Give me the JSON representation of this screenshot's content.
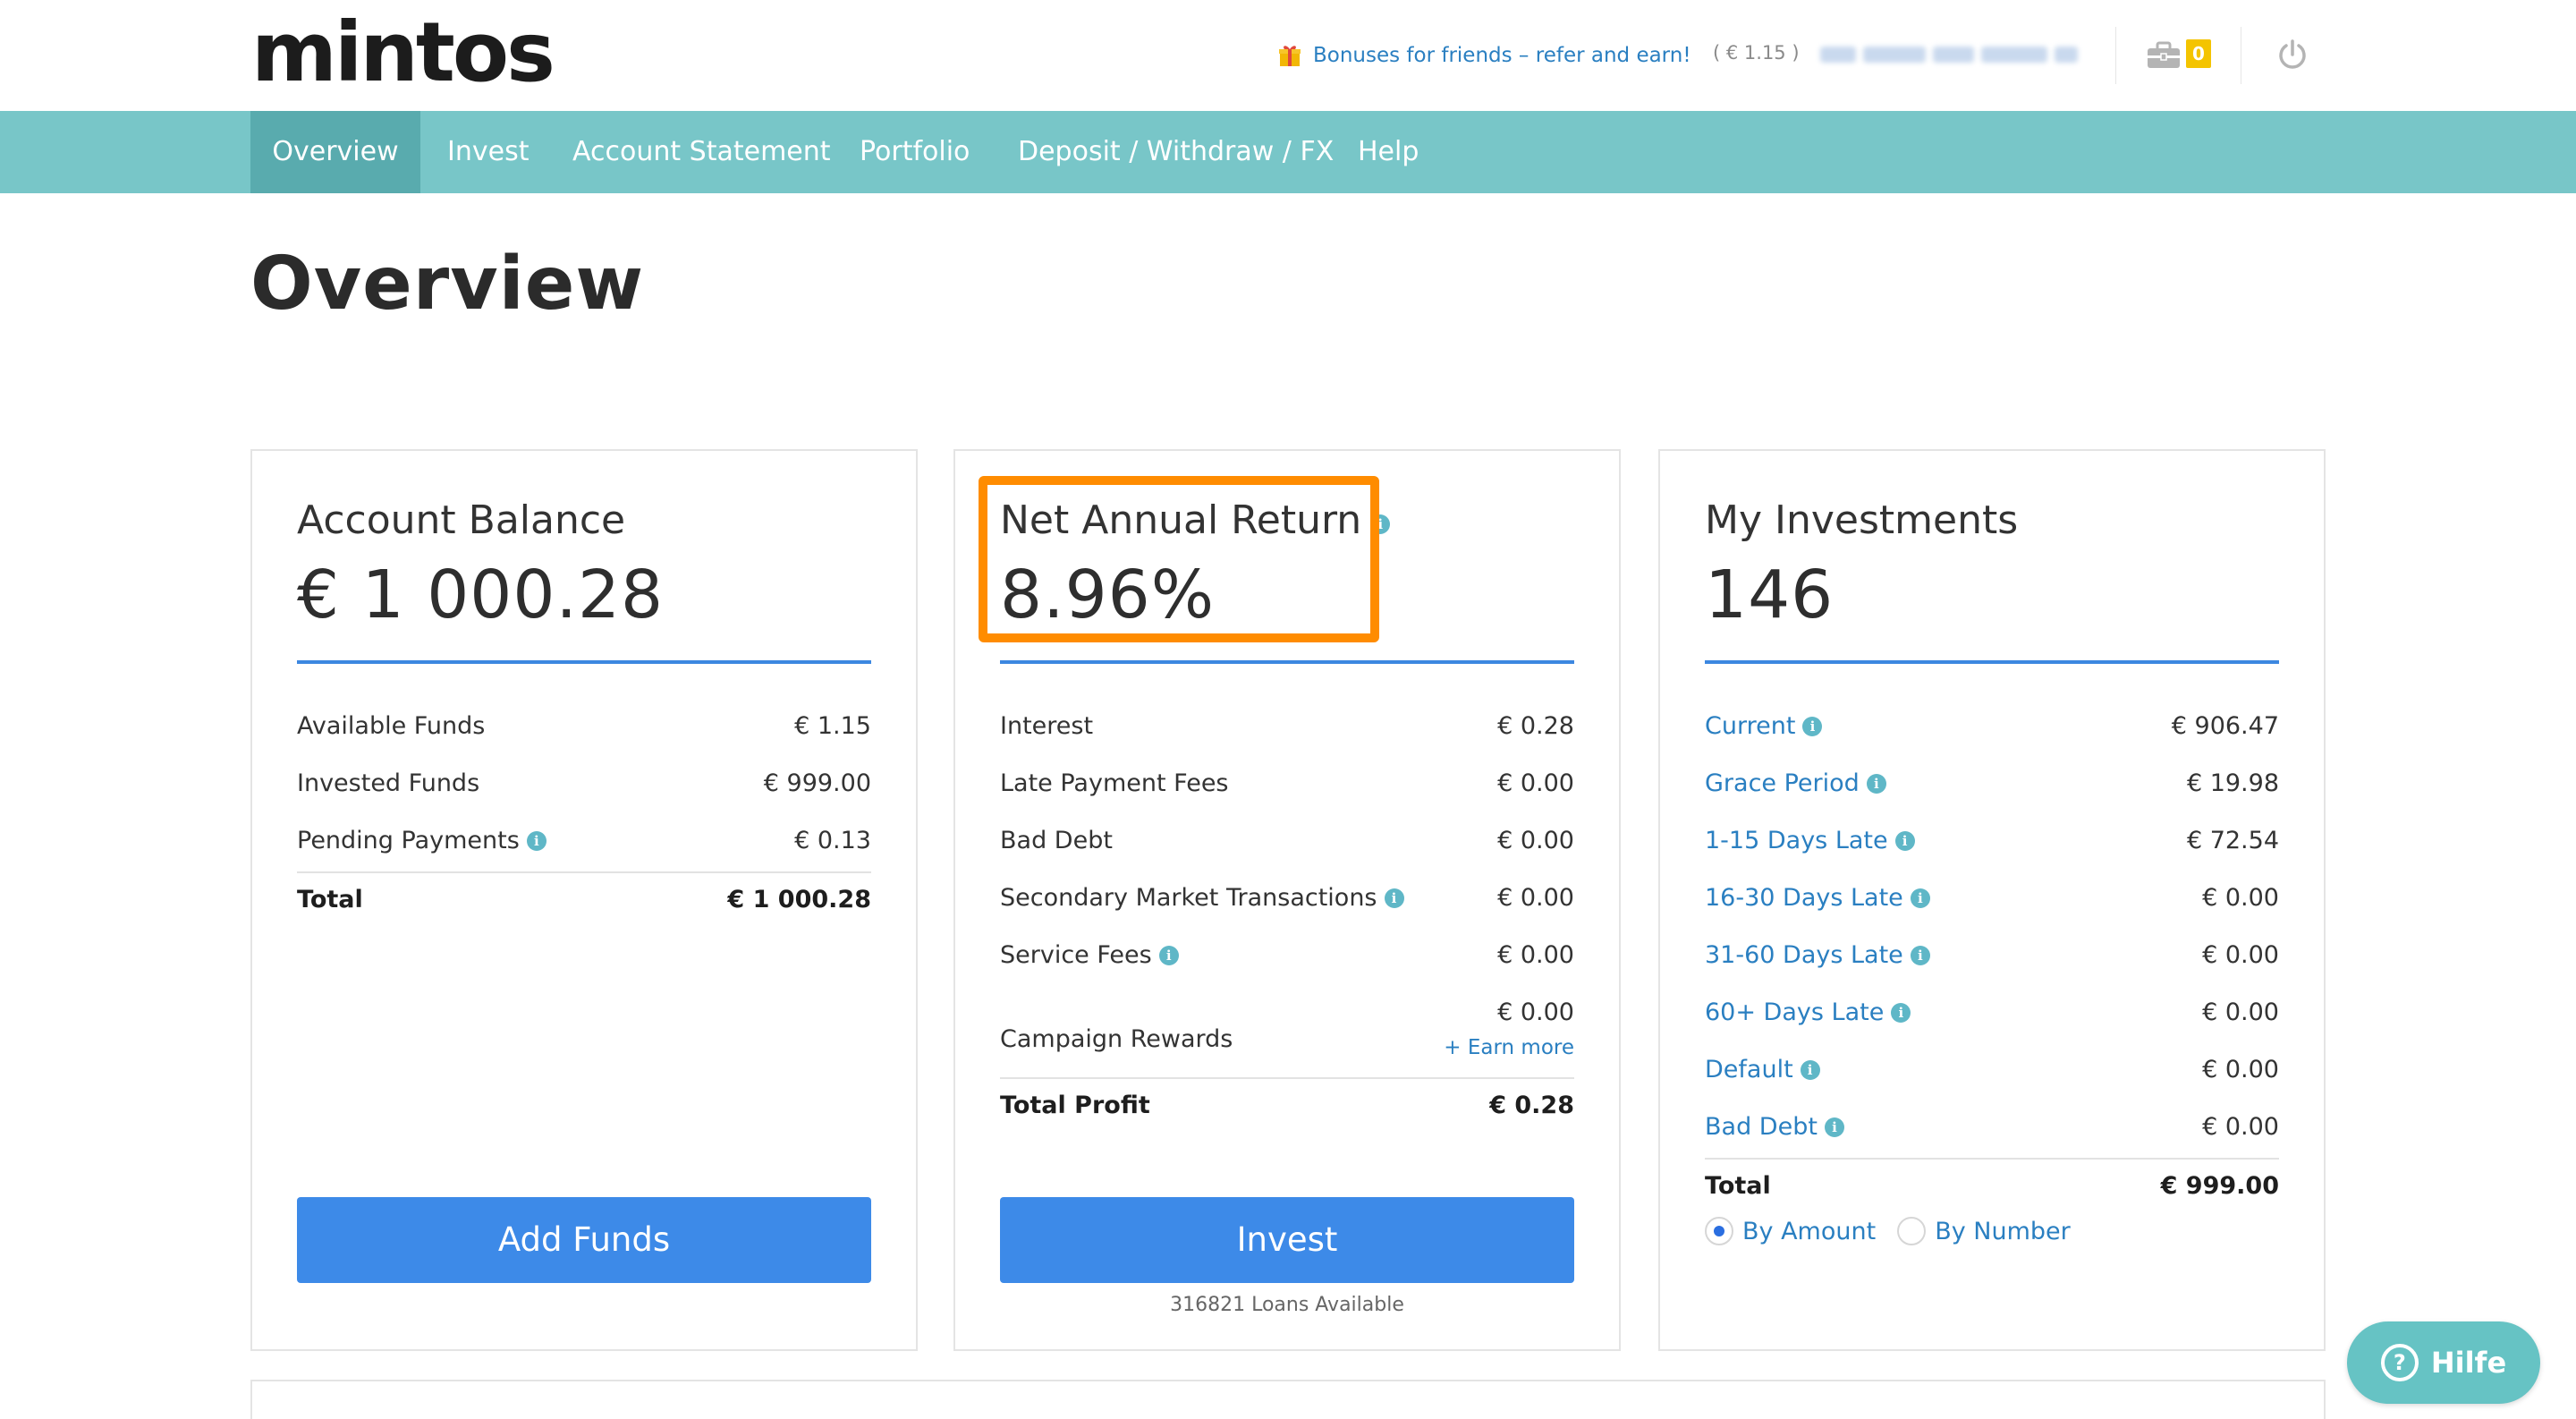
{
  "header": {
    "logo": "mintos",
    "bonus_link": "Bonuses for friends – refer and earn!",
    "balance": "( € 1.15 )",
    "briefcase_count": "0",
    "icons": {
      "gift": "gift-icon",
      "briefcase": "briefcase-icon",
      "power": "power-icon"
    },
    "colors": {
      "badge": "#f4c400",
      "link": "#2a7fc1"
    }
  },
  "nav": {
    "items": [
      {
        "label": "Overview",
        "active": true
      },
      {
        "label": "Invest"
      },
      {
        "label": "Account Statement"
      },
      {
        "label": "Portfolio"
      },
      {
        "label": "Deposit / Withdraw / FX"
      },
      {
        "label": "Help"
      }
    ],
    "colors": {
      "bar": "#78c6c8",
      "active": "#59abae"
    }
  },
  "page_title": "Overview",
  "account_balance": {
    "title": "Account Balance",
    "value": "€ 1 000.28",
    "rows": [
      {
        "label": "Available Funds",
        "value": "€ 1.15"
      },
      {
        "label": "Invested Funds",
        "value": "€ 999.00"
      },
      {
        "label": "Pending Payments",
        "value": "€ 0.13"
      }
    ],
    "total": {
      "label": "Total",
      "value": "€ 1 000.28"
    },
    "button": "Add Funds"
  },
  "net_annual_return": {
    "title": "Net Annual Return",
    "value": "8.96%",
    "rows": [
      {
        "label": "Interest",
        "value": "€ 0.28"
      },
      {
        "label": "Late Payment Fees",
        "value": "€ 0.00"
      },
      {
        "label": "Bad Debt",
        "value": "€ 0.00"
      },
      {
        "label": "Secondary Market Transactions",
        "value": "€ 0.00"
      },
      {
        "label": "Service Fees",
        "value": "€ 0.00"
      },
      {
        "label": "Campaign Rewards",
        "value": "€ 0.00"
      }
    ],
    "earn_more": "+ Earn more",
    "total": {
      "label": "Total Profit",
      "value": "€ 0.28"
    },
    "button": "Invest",
    "loans_available": "316821 Loans Available",
    "highlight_color": "#ff8c00"
  },
  "my_investments": {
    "title": "My Investments",
    "value": "146",
    "rows": [
      {
        "label": "Current",
        "value": "€ 906.47"
      },
      {
        "label": "Grace Period",
        "value": "€ 19.98"
      },
      {
        "label": "1-15 Days Late",
        "value": "€ 72.54"
      },
      {
        "label": "16-30 Days Late",
        "value": "€ 0.00"
      },
      {
        "label": "31-60 Days Late",
        "value": "€ 0.00"
      },
      {
        "label": "60+ Days Late",
        "value": "€ 0.00"
      },
      {
        "label": "Default",
        "value": "€ 0.00"
      },
      {
        "label": "Bad Debt",
        "value": "€ 0.00"
      }
    ],
    "total": {
      "label": "Total",
      "value": "€ 999.00"
    },
    "radio": {
      "by_amount": "By Amount",
      "by_number": "By Number",
      "selected": "By Amount"
    }
  },
  "help_button": "Hilfe",
  "colors": {
    "primary_button": "#3d8ae8",
    "divider": "#3c87e0",
    "info": "#5fb7c7"
  }
}
